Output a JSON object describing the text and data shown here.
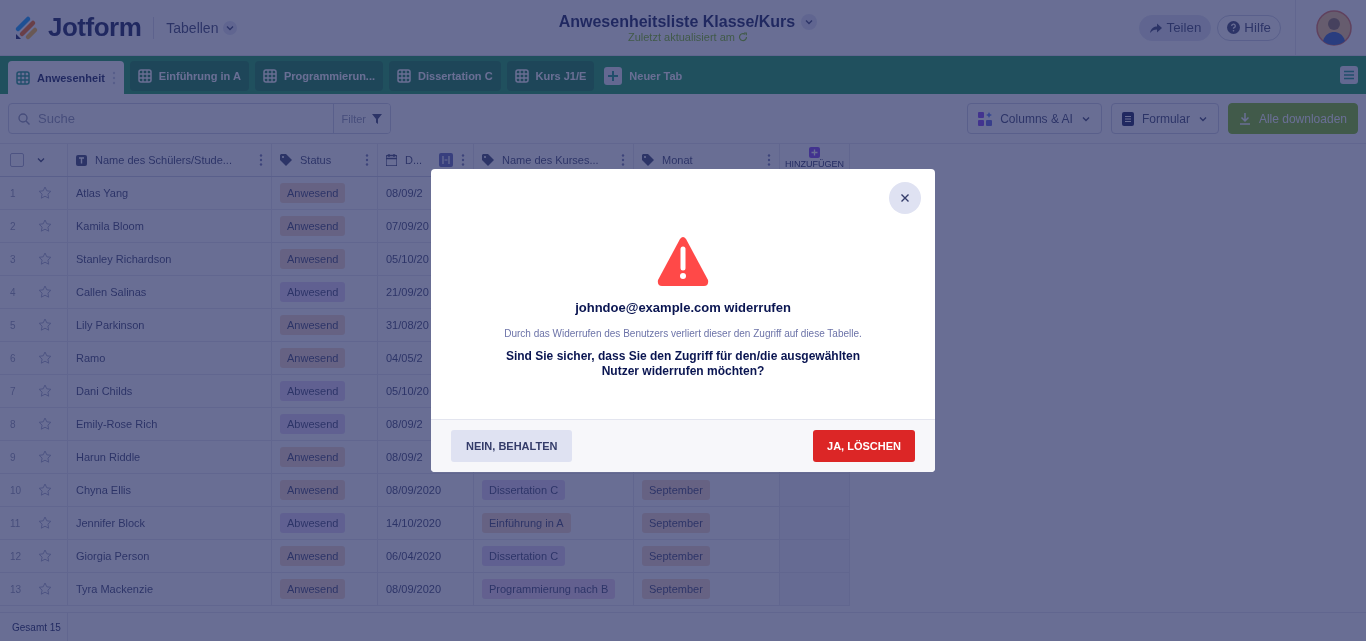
{
  "header": {
    "logo": "Jotform",
    "section": "Tabellen",
    "title": "Anwesenheitsliste Klasse/Kurs",
    "subtitle": "Zuletzt aktualisiert am",
    "share": "Teilen",
    "help": "Hilfe"
  },
  "tabs": [
    {
      "label": "Anwesenheit",
      "selected": true
    },
    {
      "label": "Einführung in A",
      "selected": false
    },
    {
      "label": "Programmierun...",
      "selected": false
    },
    {
      "label": "Dissertation C",
      "selected": false
    },
    {
      "label": "Kurs J1/E",
      "selected": false
    }
  ],
  "new_tab": "Neuer Tab",
  "toolbar": {
    "search": {
      "placeholder": "Suche"
    },
    "filter": "Filter",
    "buttons": [
      {
        "label": "Columns & AI",
        "kind": "columns"
      },
      {
        "label": "Formular",
        "kind": "form"
      },
      {
        "label": "Alle downloaden",
        "kind": "download"
      }
    ]
  },
  "table": {
    "select_all": {
      "checked": false
    },
    "columns": [
      {
        "label": "Name des Schülers/Stude...",
        "kind": "text"
      },
      {
        "label": "Status",
        "kind": "tag"
      },
      {
        "label": "D...",
        "kind": "date"
      },
      {
        "label": "Name des Kurses...",
        "kind": "tag"
      },
      {
        "label": "Monat",
        "kind": "tag"
      }
    ],
    "add_column": "HINZUFÜGEN",
    "rows": [
      {
        "number": "1",
        "name": "Atlas Yang",
        "status": {
          "text": "Anwesend",
          "color": "#676383"
        },
        "date": "08/09/2"
      },
      {
        "number": "2",
        "name": "Kamila Bloom",
        "status": {
          "text": "Anwesend",
          "color": "#676383"
        },
        "date": "07/09/20"
      },
      {
        "number": "3",
        "name": "Stanley Richardson",
        "status": {
          "text": "Anwesend",
          "color": "#676383"
        },
        "date": "05/10/20"
      },
      {
        "number": "4",
        "name": "Callen Salinas",
        "status": {
          "text": "Abwesend",
          "color": "#616191"
        },
        "date": "21/09/20"
      },
      {
        "number": "5",
        "name": "Lily Parkinson",
        "status": {
          "text": "Anwesend",
          "color": "#676383"
        },
        "date": "31/08/20"
      },
      {
        "number": "6",
        "name": "Ramo",
        "status": {
          "text": "Anwesend",
          "color": "#676383"
        },
        "date": "04/05/2"
      },
      {
        "number": "7",
        "name": "Dani Childs",
        "status": {
          "text": "Abwesend",
          "color": "#616191"
        },
        "date": "05/10/20"
      },
      {
        "number": "8",
        "name": "Emily-Rose Rich",
        "status": {
          "text": "Abwesend",
          "color": "#616191"
        },
        "date": "08/09/2"
      },
      {
        "number": "9",
        "name": "Harun Riddle",
        "status": {
          "text": "Anwesend",
          "color": "#676383"
        },
        "date": "08/09/2"
      },
      {
        "number": "10",
        "name": "Chyna Ellis",
        "status": {
          "text": "Anwesend",
          "color": "#676383"
        },
        "date": "08/09/2020",
        "course": {
          "text": "Dissertation C",
          "color": "#616191"
        },
        "month": {
          "text": "September",
          "color": "#676383"
        }
      },
      {
        "number": "11",
        "name": "Jennifer Block",
        "status": {
          "text": "Abwesend",
          "color": "#616191"
        },
        "date": "14/10/2020",
        "course": {
          "text": "Einführung in A",
          "color": "#676383"
        },
        "month": {
          "text": "September",
          "color": "#676383"
        }
      },
      {
        "number": "12",
        "name": "Giorgia Person",
        "status": {
          "text": "Anwesend",
          "color": "#676383"
        },
        "date": "06/04/2020",
        "course": {
          "text": "Dissertation C",
          "color": "#616191"
        },
        "month": {
          "text": "September",
          "color": "#676383"
        }
      },
      {
        "number": "13",
        "name": "Tyra Mackenzie",
        "status": {
          "text": "Anwesend",
          "color": "#676383"
        },
        "date": "08/09/2020",
        "course": {
          "text": "Programmierung nach B",
          "color": "#64618f"
        },
        "month": {
          "text": "September",
          "color": "#676383"
        }
      }
    ]
  },
  "footer": {
    "total": "Gesamt 15"
  },
  "dialog": {
    "title": "johndoe@example.com widerrufen",
    "description": "Durch das Widerrufen des Benutzers verliert dieser den Zugriff auf diese Tabelle.",
    "question": "Sind Sie sicher, dass Sie den Zugriff für den/die ausgewählten Nutzer widerrufen möchten?",
    "cancel": "NEIN, BEHALTEN",
    "confirm": "JA, LÖSCHEN"
  }
}
